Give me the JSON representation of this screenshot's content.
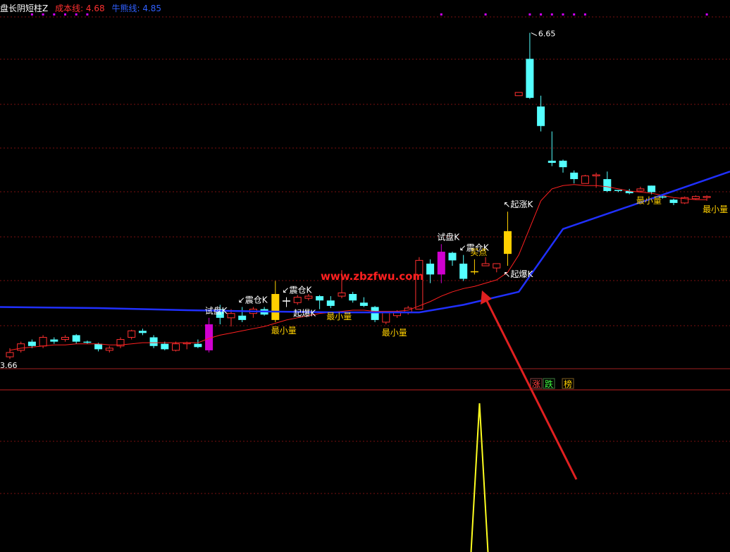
{
  "header": {
    "indicator_name": "盘长阴短柱Z",
    "cost_line_label": "成本线: 4.68",
    "bull_line_label": "牛熊线: 4.85"
  },
  "chart_data": {
    "type": "candlestick",
    "price_axis": {
      "high_label": "6.65",
      "low_label": "3.66"
    },
    "candles": [
      {
        "o": 3.66,
        "c": 3.7,
        "h": 3.74,
        "l": 3.64,
        "up": true
      },
      {
        "o": 3.72,
        "c": 3.78,
        "h": 3.8,
        "l": 3.7,
        "up": true
      },
      {
        "o": 3.8,
        "c": 3.76,
        "h": 3.82,
        "l": 3.74,
        "up": false
      },
      {
        "o": 3.76,
        "c": 3.84,
        "h": 3.86,
        "l": 3.74,
        "up": true
      },
      {
        "o": 3.82,
        "c": 3.8,
        "h": 3.84,
        "l": 3.78,
        "up": false
      },
      {
        "o": 3.82,
        "c": 3.84,
        "h": 3.86,
        "l": 3.8,
        "up": true
      },
      {
        "o": 3.86,
        "c": 3.8,
        "h": 3.87,
        "l": 3.78,
        "up": false
      },
      {
        "o": 3.8,
        "c": 3.79,
        "h": 3.81,
        "l": 3.78,
        "up": false
      },
      {
        "o": 3.78,
        "c": 3.73,
        "h": 3.79,
        "l": 3.71,
        "up": false
      },
      {
        "o": 3.72,
        "c": 3.74,
        "h": 3.76,
        "l": 3.7,
        "up": true
      },
      {
        "o": 3.76,
        "c": 3.82,
        "h": 3.84,
        "l": 3.74,
        "up": true
      },
      {
        "o": 3.84,
        "c": 3.9,
        "h": 3.91,
        "l": 3.82,
        "up": true
      },
      {
        "o": 3.9,
        "c": 3.88,
        "h": 3.92,
        "l": 3.86,
        "up": false
      },
      {
        "o": 3.84,
        "c": 3.76,
        "h": 3.86,
        "l": 3.74,
        "up": false
      },
      {
        "o": 3.78,
        "c": 3.73,
        "h": 3.8,
        "l": 3.72,
        "up": false
      },
      {
        "o": 3.72,
        "c": 3.78,
        "h": 3.8,
        "l": 3.71,
        "up": true
      },
      {
        "o": 3.78,
        "c": 3.79,
        "h": 3.8,
        "l": 3.73,
        "up": true
      },
      {
        "o": 3.78,
        "c": 3.75,
        "h": 3.82,
        "l": 3.74,
        "up": false
      },
      {
        "o": 3.72,
        "c": 3.96,
        "h": 4.02,
        "l": 3.7,
        "up": true,
        "color": "#d000d0"
      },
      {
        "o": 4.1,
        "c": 4.02,
        "h": 4.14,
        "l": 3.96,
        "up": false
      },
      {
        "o": 4.02,
        "c": 4.06,
        "h": 4.1,
        "l": 3.94,
        "up": true
      },
      {
        "o": 4.04,
        "c": 4.0,
        "h": 4.12,
        "l": 3.98,
        "up": false
      },
      {
        "o": 4.06,
        "c": 4.1,
        "h": 4.12,
        "l": 4.02,
        "up": true
      },
      {
        "o": 4.1,
        "c": 4.05,
        "h": 4.12,
        "l": 4.04,
        "up": false
      },
      {
        "o": 4.0,
        "c": 4.24,
        "h": 4.36,
        "l": 3.98,
        "up": true,
        "color": "#ffd000"
      },
      {
        "o": 4.17,
        "c": 4.18,
        "h": 4.21,
        "l": 4.12,
        "up": false,
        "color": "#ffffff"
      },
      {
        "o": 4.16,
        "c": 4.21,
        "h": 4.23,
        "l": 4.14,
        "up": true
      },
      {
        "o": 4.2,
        "c": 4.22,
        "h": 4.24,
        "l": 4.18,
        "up": true
      },
      {
        "o": 4.22,
        "c": 4.18,
        "h": 4.23,
        "l": 4.1,
        "up": false
      },
      {
        "o": 4.18,
        "c": 4.13,
        "h": 4.22,
        "l": 4.11,
        "up": false
      },
      {
        "o": 4.22,
        "c": 4.25,
        "h": 4.46,
        "l": 4.2,
        "up": true
      },
      {
        "o": 4.24,
        "c": 4.18,
        "h": 4.26,
        "l": 4.16,
        "up": false
      },
      {
        "o": 4.16,
        "c": 4.13,
        "h": 4.21,
        "l": 4.12,
        "up": false
      },
      {
        "o": 4.12,
        "c": 4.0,
        "h": 4.13,
        "l": 3.98,
        "up": false
      },
      {
        "o": 3.98,
        "c": 4.07,
        "h": 4.07,
        "l": 3.96,
        "up": true
      },
      {
        "o": 4.04,
        "c": 4.07,
        "h": 4.09,
        "l": 4.02,
        "up": true
      },
      {
        "o": 4.07,
        "c": 4.11,
        "h": 4.13,
        "l": 4.05,
        "up": true
      },
      {
        "o": 4.1,
        "c": 4.55,
        "h": 4.58,
        "l": 4.1,
        "up": true
      },
      {
        "o": 4.52,
        "c": 4.42,
        "h": 4.56,
        "l": 4.34,
        "up": false
      },
      {
        "o": 4.42,
        "c": 4.63,
        "h": 4.7,
        "l": 4.34,
        "up": true,
        "color": "#d000d0"
      },
      {
        "o": 4.62,
        "c": 4.55,
        "h": 4.63,
        "l": 4.5,
        "up": false
      },
      {
        "o": 4.52,
        "c": 4.38,
        "h": 4.6,
        "l": 4.36,
        "up": false
      },
      {
        "o": 4.45,
        "c": 4.44,
        "h": 4.56,
        "l": 4.42,
        "up": false,
        "color": "#ffd000"
      },
      {
        "o": 4.5,
        "c": 4.52,
        "h": 4.58,
        "l": 4.5,
        "up": true
      },
      {
        "o": 4.48,
        "c": 4.52,
        "h": 4.52,
        "l": 4.44,
        "up": true
      },
      {
        "o": 4.61,
        "c": 4.82,
        "h": 5.0,
        "l": 4.5,
        "up": true,
        "color": "#ffd000"
      },
      {
        "o": 6.07,
        "c": 6.1,
        "h": 6.1,
        "l": 6.07,
        "up": true
      },
      {
        "o": 6.05,
        "c": 6.41,
        "h": 6.65,
        "l": 6.04,
        "up": false
      },
      {
        "o": 5.97,
        "c": 5.79,
        "h": 6.07,
        "l": 5.74,
        "up": false
      },
      {
        "o": 5.47,
        "c": 5.45,
        "h": 5.74,
        "l": 5.42,
        "up": false
      },
      {
        "o": 5.47,
        "c": 5.41,
        "h": 5.48,
        "l": 5.36,
        "up": false
      },
      {
        "o": 5.36,
        "c": 5.3,
        "h": 5.38,
        "l": 5.26,
        "up": false
      },
      {
        "o": 5.26,
        "c": 5.33,
        "h": 5.34,
        "l": 5.26,
        "up": true
      },
      {
        "o": 5.34,
        "c": 5.33,
        "h": 5.36,
        "l": 5.22,
        "up": true
      },
      {
        "o": 5.3,
        "c": 5.19,
        "h": 5.37,
        "l": 5.18,
        "up": false
      },
      {
        "o": 5.2,
        "c": 5.19,
        "h": 5.2,
        "l": 5.18,
        "up": false
      },
      {
        "o": 5.19,
        "c": 5.17,
        "h": 5.21,
        "l": 5.16,
        "up": false
      },
      {
        "o": 5.19,
        "c": 5.21,
        "h": 5.23,
        "l": 5.18,
        "up": true
      },
      {
        "o": 5.24,
        "c": 5.18,
        "h": 5.24,
        "l": 5.16,
        "up": false
      },
      {
        "o": 5.14,
        "c": 5.13,
        "h": 5.15,
        "l": 5.12,
        "up": false
      },
      {
        "o": 5.11,
        "c": 5.08,
        "h": 5.12,
        "l": 5.06,
        "up": false
      },
      {
        "o": 5.08,
        "c": 5.13,
        "h": 5.14,
        "l": 5.07,
        "up": true
      },
      {
        "o": 5.12,
        "c": 5.14,
        "h": 5.15,
        "l": 5.11,
        "up": true
      },
      {
        "o": 5.13,
        "c": 5.14,
        "h": 5.15,
        "l": 5.1,
        "up": true
      }
    ],
    "cost_line": [
      3.72,
      3.74,
      3.75,
      3.76,
      3.77,
      3.77,
      3.78,
      3.78,
      3.78,
      3.77,
      3.77,
      3.78,
      3.79,
      3.79,
      3.79,
      3.79,
      3.79,
      3.79,
      3.83,
      3.86,
      3.88,
      3.9,
      3.92,
      3.94,
      3.97,
      4.0,
      4.02,
      4.04,
      4.06,
      4.07,
      4.08,
      4.09,
      4.09,
      4.08,
      4.08,
      4.08,
      4.09,
      4.13,
      4.17,
      4.22,
      4.26,
      4.29,
      4.31,
      4.34,
      4.37,
      4.44,
      4.6,
      4.85,
      5.1,
      5.21,
      5.24,
      5.25,
      5.24,
      5.24,
      5.23,
      5.21,
      5.19,
      5.18,
      5.17,
      5.15,
      5.13,
      5.12,
      5.11,
      5.11
    ],
    "bull_line": [
      {
        "i": 0,
        "v": 4.12
      },
      {
        "i": 8,
        "v": 4.11
      },
      {
        "i": 16,
        "v": 4.09
      },
      {
        "i": 22,
        "v": 4.08
      },
      {
        "i": 30,
        "v": 4.07
      },
      {
        "i": 37,
        "v": 4.07
      },
      {
        "i": 41,
        "v": 4.14
      },
      {
        "i": 46,
        "v": 4.26
      },
      {
        "i": 50,
        "v": 4.84
      },
      {
        "i": 56,
        "v": 5.05
      },
      {
        "i": 63,
        "v": 5.37
      }
    ],
    "purple_markers": [
      2,
      3,
      4,
      5,
      6,
      7,
      39,
      43,
      47,
      48,
      49,
      50,
      51,
      52,
      63
    ],
    "annotations": [
      {
        "i": 18,
        "text": "试盘K",
        "pos": "above",
        "color": "#ffffff"
      },
      {
        "i": 21,
        "text": "↙震仓K",
        "pos": "above",
        "color": "#ffffff"
      },
      {
        "i": 25,
        "text": "↙震仓K",
        "pos": "above",
        "color": "#ffffff"
      },
      {
        "i": 24,
        "text": "最小量",
        "pos": "below",
        "color": "#ffd000"
      },
      {
        "i": 26,
        "text": "起爆K",
        "pos": "below",
        "color": "#ffffff"
      },
      {
        "i": 29,
        "text": "最小量",
        "pos": "below",
        "color": "#ffd000"
      },
      {
        "i": 34,
        "text": "最小量",
        "pos": "below",
        "color": "#ffd000"
      },
      {
        "i": 39,
        "text": "试盘K",
        "pos": "above",
        "color": "#ffffff"
      },
      {
        "i": 41,
        "text": "↙震仓K",
        "pos": "above",
        "color": "#ffffff"
      },
      {
        "i": 42,
        "text": "买点",
        "pos": "above",
        "color": "#ffd000"
      },
      {
        "i": 45,
        "text": "↖起涨K",
        "pos": "above",
        "color": "#ffffff"
      },
      {
        "i": 45,
        "text": "↖起爆K",
        "pos": "below",
        "color": "#ffffff"
      },
      {
        "i": 57,
        "text": "最小量",
        "pos": "below",
        "color": "#ffd000"
      },
      {
        "i": 63,
        "text": "最小量",
        "pos": "below",
        "color": "#ffd000"
      }
    ],
    "watermark": "www.zbzfwu.com",
    "sub_panel": {
      "tags": [
        {
          "text": "涨",
          "color": "#ff4040",
          "border": "#804040"
        },
        {
          "text": "跌",
          "color": "#40ff40",
          "border": "#408040"
        },
        {
          "text": "榜",
          "color": "#ffd000",
          "border": "#806020"
        }
      ],
      "spike_index": 45
    }
  }
}
